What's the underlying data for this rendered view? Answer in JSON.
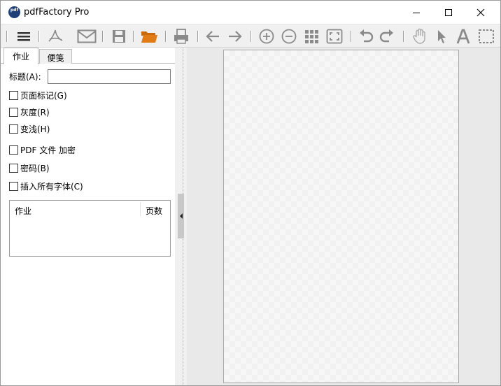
{
  "window": {
    "title": "pdfFactory Pro",
    "app_icon_text": "pdf"
  },
  "toolbar": {
    "icons": [
      "menu-icon",
      "acrobat-icon",
      "email-icon",
      "save-icon",
      "open-folder-icon",
      "print-icon",
      "back-arrow-icon",
      "forward-arrow-icon",
      "zoom-in-icon",
      "zoom-out-icon",
      "thumbnails-icon",
      "fit-page-icon",
      "undo-icon",
      "redo-icon",
      "hand-icon",
      "pointer-icon",
      "text-icon",
      "select-area-icon"
    ],
    "accent_folder": "#e07b16",
    "icon_color": "#8a8a8a"
  },
  "tabs": [
    "作业",
    "便笺"
  ],
  "form": {
    "title_label": "标题(A):",
    "title_value": "",
    "checkboxes": [
      {
        "label": "页面标记(G)",
        "checked": false
      },
      {
        "label": "灰度(R)",
        "checked": false
      },
      {
        "label": "变浅(H)",
        "checked": false
      },
      {
        "label": "PDF 文件 加密",
        "checked": false
      },
      {
        "label": "密码(B)",
        "checked": false
      },
      {
        "label": "插入所有字体(C)",
        "checked": false
      }
    ]
  },
  "job_list": {
    "columns": [
      "作业",
      "页数"
    ],
    "rows": []
  }
}
